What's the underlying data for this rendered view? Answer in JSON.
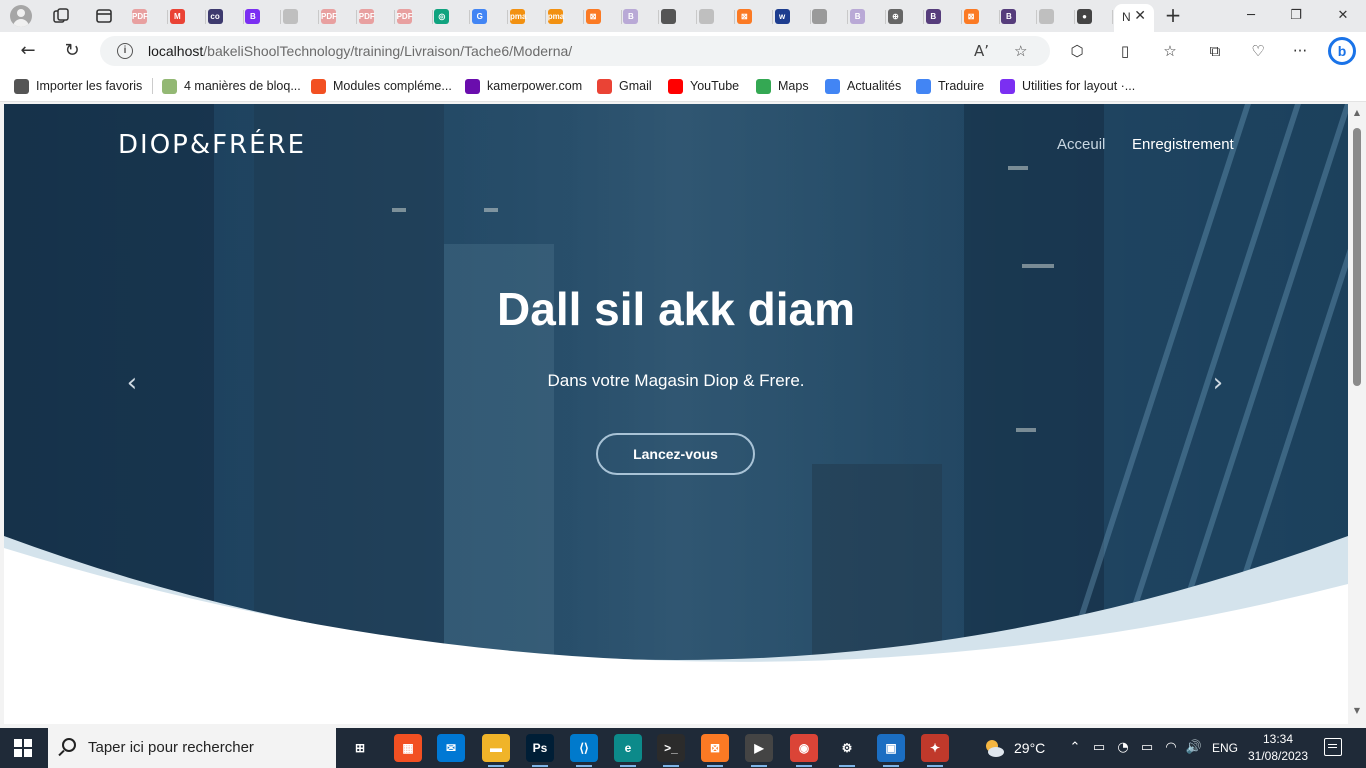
{
  "browser": {
    "tabs": [
      {
        "icon": "pdf-icon",
        "badge": "PDF",
        "color": "#e8a0a0"
      },
      {
        "icon": "gmail-icon",
        "badge": "M",
        "color": "#ea4335"
      },
      {
        "icon": "coolors-icon",
        "badge": "co",
        "color": "#3d3a6e"
      },
      {
        "icon": "bootstrap-icon",
        "badge": "B",
        "color": "#7b2ff2"
      },
      {
        "icon": "file-icon",
        "badge": "",
        "color": "#bfbfbf"
      },
      {
        "icon": "pdf-icon",
        "badge": "PDF",
        "color": "#e8a0a0"
      },
      {
        "icon": "pdf-icon",
        "badge": "PDF",
        "color": "#e8a0a0"
      },
      {
        "icon": "pdf-icon",
        "badge": "PDF",
        "color": "#e8a0a0"
      },
      {
        "icon": "chatgpt-icon",
        "badge": "◎",
        "color": "#10a37f"
      },
      {
        "icon": "google-icon",
        "badge": "G",
        "color": "#4285f4"
      },
      {
        "icon": "phpmyadmin-icon",
        "badge": "pma",
        "color": "#f29111"
      },
      {
        "icon": "phpmyadmin-icon",
        "badge": "pma",
        "color": "#f29111"
      },
      {
        "icon": "xampp-icon",
        "badge": "⊠",
        "color": "#fb7a24"
      },
      {
        "icon": "bootstrap-icon",
        "badge": "B",
        "color": "#b9a9d6"
      },
      {
        "icon": "document-icon",
        "badge": "",
        "color": "#555555"
      },
      {
        "icon": "file-icon",
        "badge": "",
        "color": "#bfbfbf"
      },
      {
        "icon": "xampp-icon",
        "badge": "⊠",
        "color": "#fb7a24"
      },
      {
        "icon": "webflow-icon",
        "badge": "w",
        "color": "#1d3d8f"
      },
      {
        "icon": "form-icon",
        "badge": "",
        "color": "#9a9a9a"
      },
      {
        "icon": "bootstrap-icon",
        "badge": "B",
        "color": "#b9a9d6"
      },
      {
        "icon": "globe-icon",
        "badge": "⊕",
        "color": "#666666"
      },
      {
        "icon": "bootstrap-icon",
        "badge": "B",
        "color": "#563d7c"
      },
      {
        "icon": "xampp-icon",
        "badge": "⊠",
        "color": "#fb7a24"
      },
      {
        "icon": "bootstrap-icon",
        "badge": "B",
        "color": "#563d7c"
      },
      {
        "icon": "file-icon",
        "badge": "",
        "color": "#bfbfbf"
      },
      {
        "icon": "github-icon",
        "badge": "●",
        "color": "#444444"
      }
    ],
    "active_tab_label": "N",
    "active_tab_close": "✕",
    "new_tab": "+",
    "minimize": "─",
    "maximize": "❐",
    "close": "✕",
    "back": "←",
    "refresh": "↻",
    "info_icon": "i",
    "url_host": "localhost",
    "url_path": "/bakeliShoolTechnology/training/Livraison/Tache6/Moderna/",
    "read_aloud": "Aʼ",
    "favorite_star": "☆",
    "extensions": "⬡",
    "split_screen": "▯",
    "favorites": "☆",
    "collections": "⧉",
    "performance": "♡",
    "more": "···",
    "bing": "b"
  },
  "favorites_bar": [
    {
      "label": "Importer les favoris",
      "icon": "import-icon",
      "color": "#555555"
    },
    {
      "label": "4 manières de bloq...",
      "icon": "wikihow-icon",
      "color": "#93b874"
    },
    {
      "label": "Modules compléme...",
      "icon": "microsoft-icon",
      "color": "#f25022"
    },
    {
      "label": "kamerpower.com",
      "icon": "kamerpower-icon",
      "color": "#6a0dad"
    },
    {
      "label": "Gmail",
      "icon": "gmail-icon",
      "color": "#ea4335"
    },
    {
      "label": "YouTube",
      "icon": "youtube-icon",
      "color": "#ff0000"
    },
    {
      "label": "Maps",
      "icon": "maps-icon",
      "color": "#34a853"
    },
    {
      "label": "Actualités",
      "icon": "news-icon",
      "color": "#4285f4"
    },
    {
      "label": "Traduire",
      "icon": "translate-icon",
      "color": "#4285f4"
    },
    {
      "label": "Utilities for layout ·...",
      "icon": "bootstrap-icon",
      "color": "#7b2ff2"
    }
  ],
  "site": {
    "brand": "DIOP&FRÉRE",
    "nav_home": "Acceuil",
    "nav_register": "Enregistrement",
    "hero_title": "Dall sil akk diam",
    "hero_subtitle": "Dans votre Magasin Diop & Frere.",
    "cta_label": "Lancez-vous",
    "prev_arrow": "‹",
    "next_arrow": "›",
    "wave_color": "#d4e3ec"
  },
  "taskbar": {
    "search_placeholder": "Taper ici pour rechercher",
    "apps": [
      {
        "icon": "task-view-icon",
        "badge": "⊞",
        "color": "transparent"
      },
      {
        "icon": "microsoft-store-icon",
        "badge": "▦",
        "color": "#f25022"
      },
      {
        "icon": "mail-icon",
        "badge": "✉",
        "color": "#0078d4"
      },
      {
        "icon": "file-explorer-icon",
        "badge": "▬",
        "color": "#f0b429"
      },
      {
        "icon": "photoshop-icon",
        "badge": "Ps",
        "color": "#001e36"
      },
      {
        "icon": "vscode-icon",
        "badge": "⟨⟩",
        "color": "#007acc"
      },
      {
        "icon": "edge-icon",
        "badge": "e",
        "color": "#0c8a8a"
      },
      {
        "icon": "terminal-icon",
        "badge": ">_",
        "color": "#2b2b2b"
      },
      {
        "icon": "xampp-icon",
        "badge": "⊠",
        "color": "#fb7a24"
      },
      {
        "icon": "media-player-icon",
        "badge": "▶",
        "color": "#444444"
      },
      {
        "icon": "chrome-icon",
        "badge": "◉",
        "color": "#db4437"
      },
      {
        "icon": "settings-icon",
        "badge": "⚙",
        "color": "transparent"
      },
      {
        "icon": "screen-share-icon",
        "badge": "▣",
        "color": "#1b6ec2"
      },
      {
        "icon": "app-icon",
        "badge": "✦",
        "color": "#c0392b"
      }
    ],
    "temperature": "29°C",
    "tray_chevron": "⌃",
    "tray_meet": "▭",
    "tray_battery_alert": "◔",
    "tray_battery": "▭",
    "tray_wifi": "◠",
    "tray_volume": "🔊",
    "language": "ENG",
    "time": "13:34",
    "date": "31/08/2023"
  }
}
